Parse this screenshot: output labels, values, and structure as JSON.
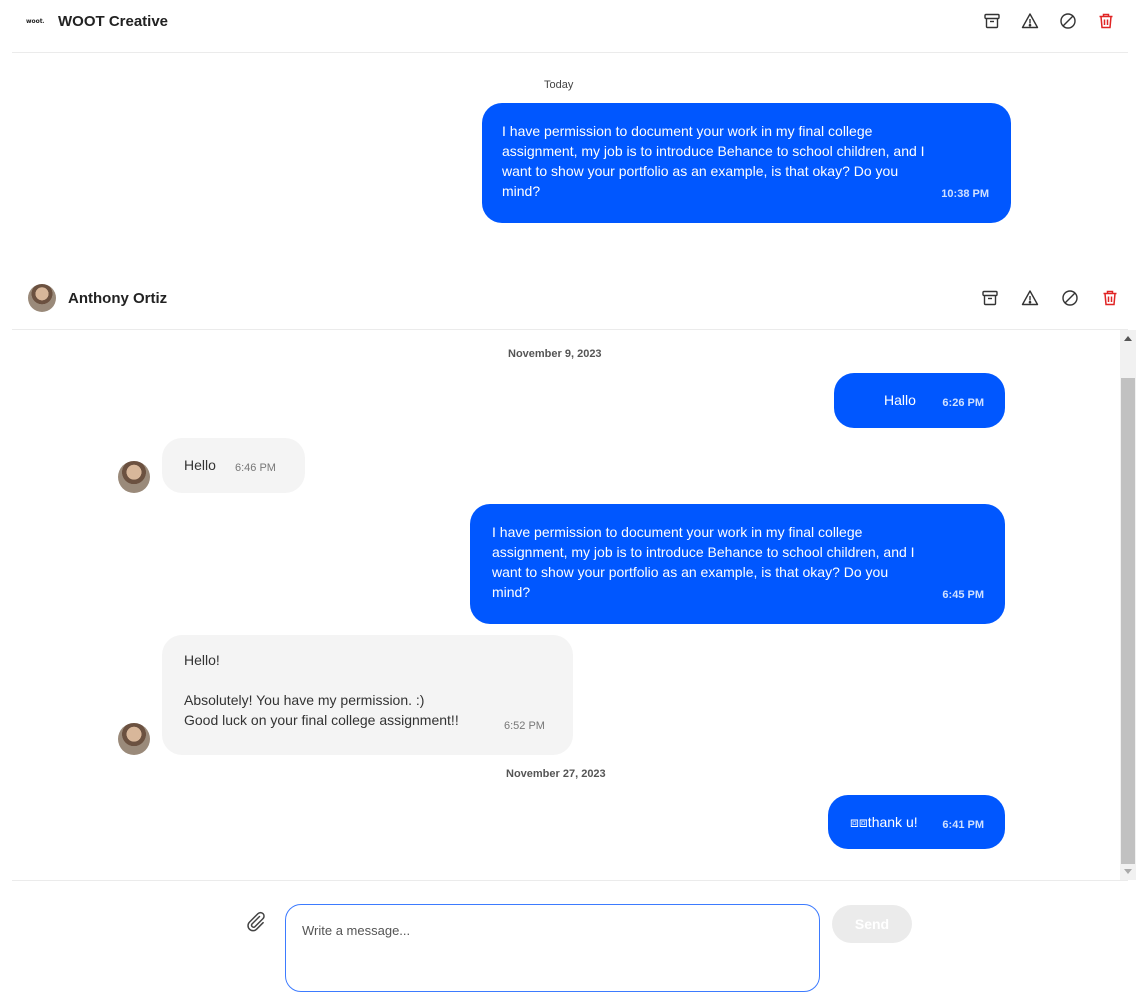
{
  "thread1": {
    "title": "WOOT Creative",
    "logo_text": "woot.",
    "date": "Today",
    "message": {
      "text": "I have permission to document your work in my final college assignment, my job is to introduce Behance to school children, and I want to show your portfolio as an example, is that okay? Do you mind?",
      "time": "10:38 PM"
    }
  },
  "thread2": {
    "title": "Anthony Ortiz",
    "dates": [
      "November 9, 2023",
      "November 27, 2023"
    ],
    "messages": [
      {
        "dir": "out",
        "text": "Hallo",
        "time": "6:26 PM"
      },
      {
        "dir": "in",
        "text": "Hello",
        "time": "6:46 PM"
      },
      {
        "dir": "out",
        "text": "I have permission to document your work in my final college assignment, my job is to introduce Behance to school children, and I want to show your portfolio as an example, is that okay? Do you mind?",
        "time": "6:45 PM"
      },
      {
        "dir": "in",
        "text": "Hello!\n\nAbsolutely! You have my permission. :)\nGood luck on your final college assignment!!",
        "time": "6:52 PM"
      },
      {
        "dir": "out",
        "text": "⧈⧈thank u!",
        "time": "6:41 PM"
      }
    ]
  },
  "actions": {
    "icons": [
      "archive-icon",
      "report-icon",
      "block-icon",
      "delete-icon"
    ],
    "delete_color": "#e02424"
  },
  "composer": {
    "placeholder": "Write a message...",
    "send_label": "Send"
  },
  "colors": {
    "outgoing_bubble": "#0057ff",
    "incoming_bubble": "#f4f4f4",
    "input_border": "#3d7bff"
  }
}
